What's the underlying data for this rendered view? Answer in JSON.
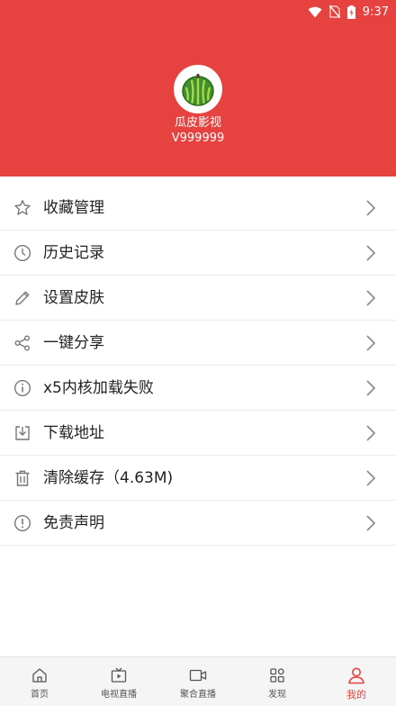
{
  "status_bar": {
    "time": "9:37"
  },
  "profile": {
    "name": "瓜皮影视",
    "version": "V999999"
  },
  "menu": [
    {
      "label": "收藏管理",
      "icon": "star-icon"
    },
    {
      "label": "历史记录",
      "icon": "clock-icon"
    },
    {
      "label": "设置皮肤",
      "icon": "pencil-icon"
    },
    {
      "label": "一键分享",
      "icon": "share-icon"
    },
    {
      "label": "x5内核加载失败",
      "icon": "info-icon"
    },
    {
      "label": "下载地址",
      "icon": "download-icon"
    },
    {
      "label": "清除缓存（4.63M)",
      "icon": "trash-icon"
    },
    {
      "label": "免责声明",
      "icon": "alert-icon"
    }
  ],
  "tabs": [
    {
      "label": "首页",
      "icon": "home-icon"
    },
    {
      "label": "电视直播",
      "icon": "tv-icon"
    },
    {
      "label": "聚合直播",
      "icon": "video-icon"
    },
    {
      "label": "发现",
      "icon": "grid-icon"
    },
    {
      "label": "我的",
      "icon": "user-icon",
      "active": true
    }
  ],
  "colors": {
    "accent": "#e64340",
    "icon": "#777777",
    "text": "#222222"
  }
}
